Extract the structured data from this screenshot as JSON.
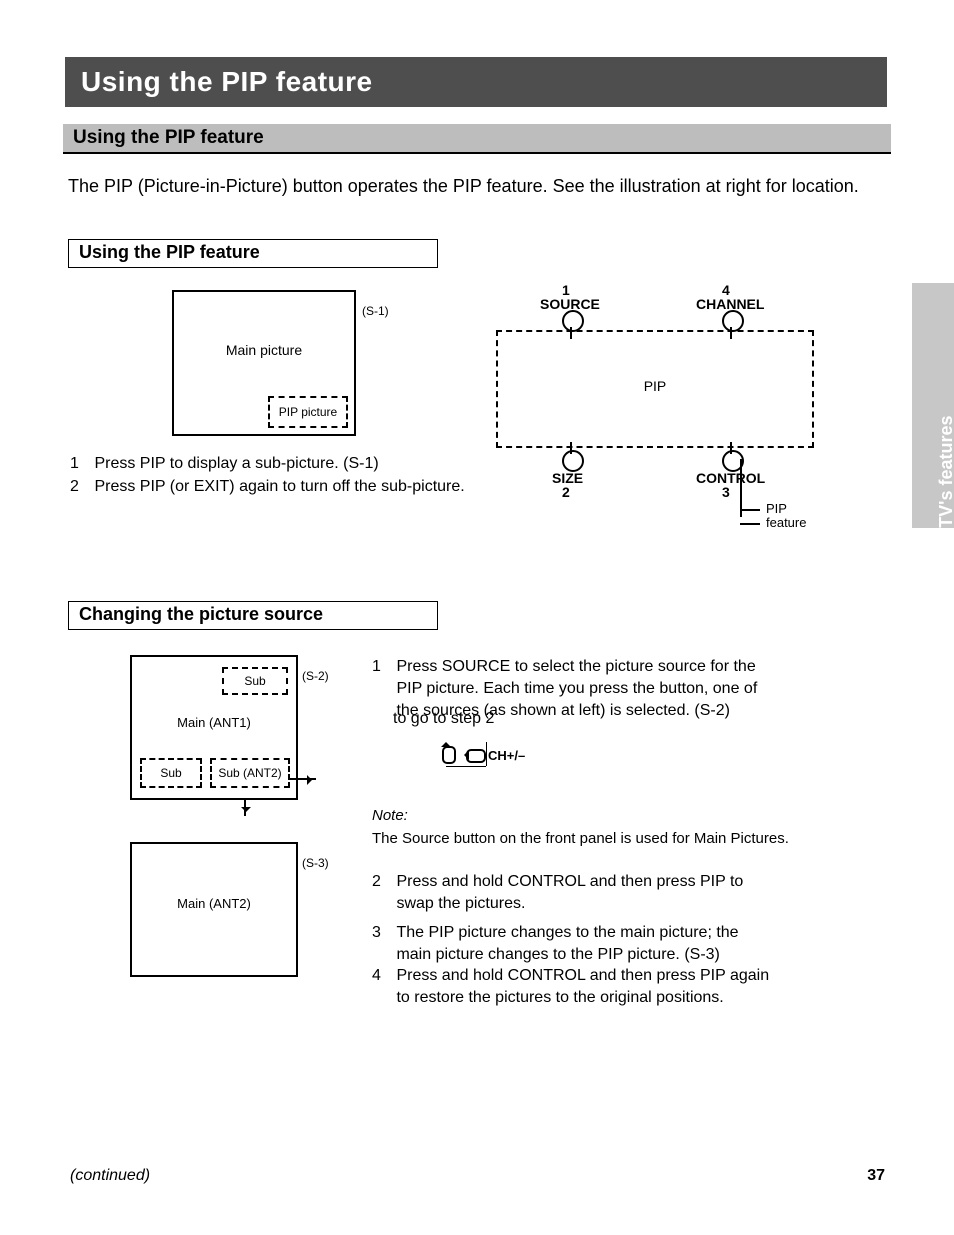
{
  "sidebar": {
    "tab": "Using the TV's features"
  },
  "header": {
    "title": "Using the PIP feature"
  },
  "subheader": {
    "title": "Using the PIP feature"
  },
  "intro": "The PIP (Picture-in-Picture) button operates the PIP feature. See the illustration at right for location.",
  "box1": {
    "title": "Using the PIP feature"
  },
  "tv1": {
    "main": "Main picture",
    "pip": "PIP picture",
    "label": "(S-1)"
  },
  "section1": {
    "step1": {
      "num": "1",
      "text": "Press PIP to display a sub-picture. (S-1)"
    },
    "step2": {
      "num": "2",
      "text": "Press PIP (or EXIT) again to turn off the sub-picture."
    }
  },
  "diagram": {
    "source_num": "1",
    "source": "SOURCE",
    "channel_num": "4",
    "channel": "CHANNEL",
    "size_num": "2",
    "size": "SIZE",
    "control_num": "3",
    "control": "CONTROL",
    "pip": "PIP",
    "caption": "PIP",
    "caption2": "feature"
  },
  "box2": {
    "title": "Changing the picture source"
  },
  "tv2": {
    "sub1": "Sub",
    "main": "Main (ANT1)",
    "sub2": "Sub",
    "sub3": "Sub (ANT2)",
    "label": "(S-2)",
    "label3": "(S-3)"
  },
  "tv3": {
    "main": "Main (ANT2)"
  },
  "section2": {
    "step1": {
      "num": "1",
      "text": "Press SOURCE to select the picture source for the PIP picture. Each time you press the button, one of the sources (as shown at left) is selected. (S-2)"
    },
    "keylegend": "CH+/–",
    "s2t": "to go to step 2",
    "note_title": "Note:",
    "note_body": "The Source button on the front panel is used for Main Pictures.",
    "step2": {
      "num": "2",
      "text": "Press and hold CONTROL and then press PIP to swap the pictures."
    },
    "step3": {
      "num": "3",
      "text": "The PIP picture changes to the main picture; the main picture changes to the PIP picture. (S-3)"
    },
    "step4": {
      "num": "4",
      "text": "Press and hold CONTROL and then press PIP again to restore the pictures to the original positions."
    }
  },
  "footer": {
    "left": "(continued)",
    "right": "37"
  }
}
